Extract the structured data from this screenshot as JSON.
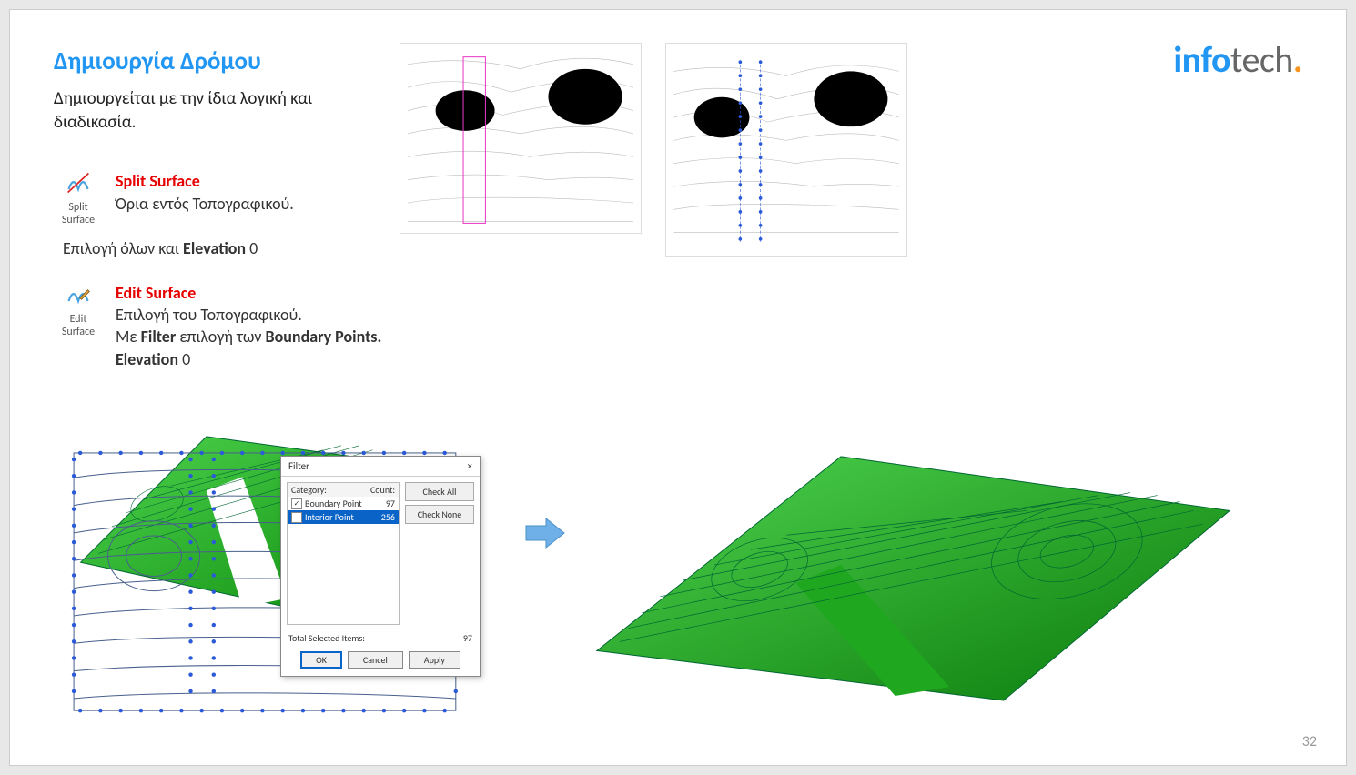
{
  "title": "Δημιουργία Δρόμου",
  "desc": "Δημιουργείται με την ίδια λογική και διαδικασία.",
  "split": {
    "cmd": "Split Surface",
    "hint": "Όρια εντός Τοπογραφικού.",
    "label": "Split\nSurface"
  },
  "sel_line_pre": "Επιλογή όλων και ",
  "sel_line_b": "Elevation",
  "sel_line_suf": " 0",
  "edit": {
    "cmd": "Edit Surface",
    "l1": "Επιλογή του Τοπογραφικού.",
    "l2a": "Με ",
    "l2b": "Filter",
    "l2c": " επιλογή των ",
    "l2d": "Boundary Points.",
    "l3a": "Elevation",
    "l3b": " 0",
    "label": "Edit\nSurface"
  },
  "logo": {
    "a": "info",
    "b": "tech",
    "c": "."
  },
  "page": "32",
  "dlg": {
    "title": "Filter",
    "close": "×",
    "cat": "Category:",
    "cnt": "Count:",
    "rows": [
      {
        "name": "Boundary Point",
        "count": "97",
        "checked": true,
        "sel": false
      },
      {
        "name": "Interior Point",
        "count": "256",
        "checked": false,
        "sel": true
      }
    ],
    "checkall": "Check All",
    "checknone": "Check None",
    "total_l": "Total Selected Items:",
    "total_v": "97",
    "ok": "OK",
    "cancel": "Cancel",
    "apply": "Apply"
  }
}
